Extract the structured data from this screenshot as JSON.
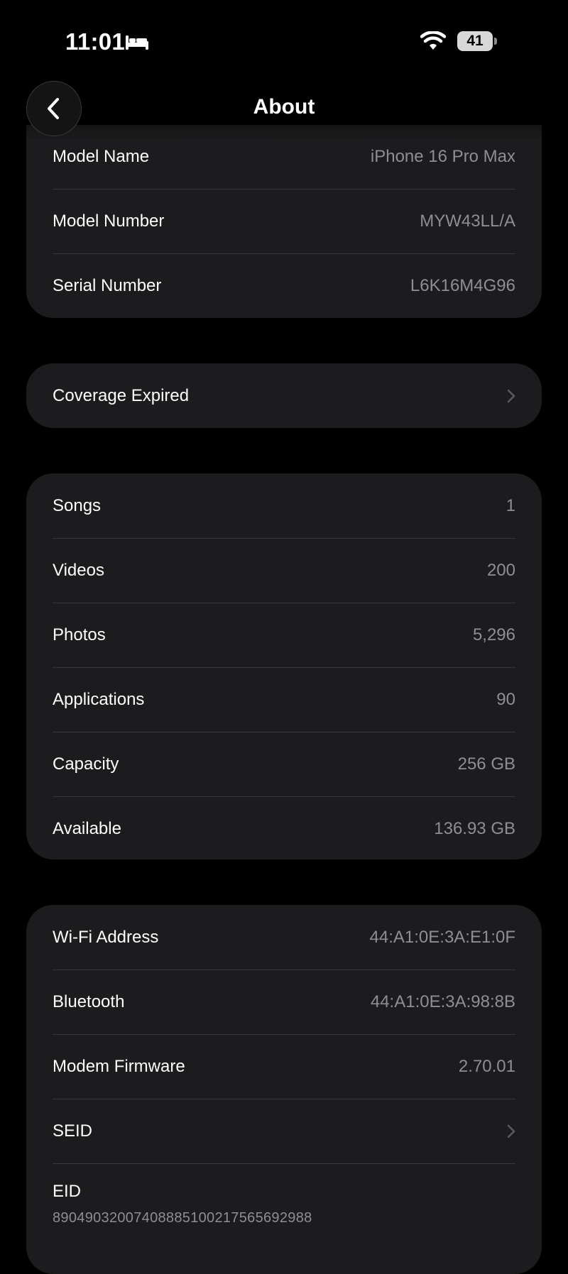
{
  "status_bar": {
    "time": "11:01",
    "battery_level": "41",
    "icons": [
      "bed-icon",
      "wifi-icon",
      "battery-icon"
    ]
  },
  "nav": {
    "title": "About",
    "back_icon": "chevron-left-icon"
  },
  "device_info": [
    {
      "label": "Model Name",
      "value": "iPhone 16 Pro Max"
    },
    {
      "label": "Model Number",
      "value": "MYW43LL/A"
    },
    {
      "label": "Serial Number",
      "value": "L6K16M4G96"
    }
  ],
  "coverage": {
    "label": "Coverage Expired"
  },
  "media_stats": [
    {
      "label": "Songs",
      "value": "1"
    },
    {
      "label": "Videos",
      "value": "200"
    },
    {
      "label": "Photos",
      "value": "5,296"
    },
    {
      "label": "Applications",
      "value": "90"
    },
    {
      "label": "Capacity",
      "value": "256 GB"
    },
    {
      "label": "Available",
      "value": "136.93 GB"
    }
  ],
  "network_info": [
    {
      "label": "Wi-Fi Address",
      "value": "44:A1:0E:3A:E1:0F"
    },
    {
      "label": "Bluetooth",
      "value": "44:A1:0E:3A:98:8B"
    },
    {
      "label": "Modem Firmware",
      "value": "2.70.01"
    },
    {
      "label": "SEID"
    },
    {
      "label": "EID",
      "value": "89049032007408885100217565692988"
    }
  ],
  "colors": {
    "background": "#000000",
    "card": "#1c1c1e",
    "secondary_text": "#8e8e93",
    "separator": "#38383a"
  }
}
